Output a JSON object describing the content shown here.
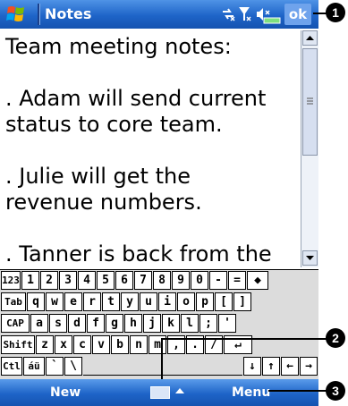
{
  "title_bar": {
    "title": "Notes",
    "ok_label": "ok",
    "icons": [
      "windows-start-icon",
      "connectivity-icon",
      "signal-icon",
      "volume-icon",
      "battery-icon"
    ]
  },
  "document": {
    "text": "Team meeting notes:\n\n. Adam will send current\nstatus to core team.\n\n. Julie will get the\nrevenue numbers.\n\n. Tanner is back from the\nconference and reports..."
  },
  "keyboard": {
    "rows": [
      [
        "123",
        "1",
        "2",
        "3",
        "4",
        "5",
        "6",
        "7",
        "8",
        "9",
        "0",
        "-",
        "=",
        "◆"
      ],
      [
        "Tab",
        "q",
        "w",
        "e",
        "r",
        "t",
        "y",
        "u",
        "i",
        "o",
        "p",
        "[",
        "]"
      ],
      [
        "CAP",
        "a",
        "s",
        "d",
        "f",
        "g",
        "h",
        "j",
        "k",
        "l",
        ";",
        "'"
      ],
      [
        "Shift",
        "z",
        "x",
        "c",
        "v",
        "b",
        "n",
        "m",
        ",",
        ".",
        "/",
        "↵"
      ],
      [
        "Ctl",
        "áü",
        "`",
        "\\",
        " ",
        "↓",
        "↑",
        "←",
        "→"
      ]
    ]
  },
  "menu_bar": {
    "left": "New",
    "right": "Menu",
    "icons": [
      "keyboard-icon",
      "up-arrow-icon"
    ]
  },
  "callouts": [
    "1",
    "2",
    "3"
  ]
}
